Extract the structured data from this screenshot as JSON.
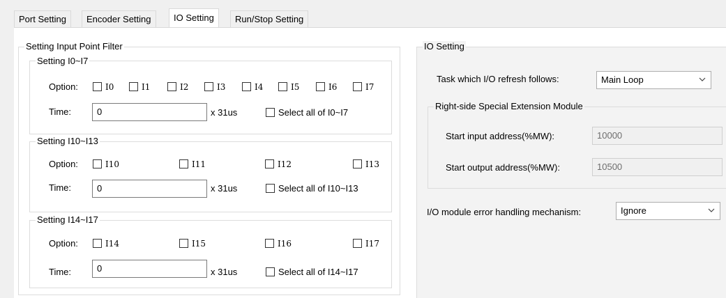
{
  "tabs": [
    "Port Setting",
    "Encoder Setting",
    "IO Setting",
    "Run/Stop Setting"
  ],
  "filter": {
    "title": "Setting Input Point Filter",
    "groups": [
      {
        "title": "Setting I0~I7",
        "option_label": "Option:",
        "options": [
          "I0",
          "I1",
          "I2",
          "I3",
          "I4",
          "I5",
          "I6",
          "I7"
        ],
        "time_label": "Time:",
        "time_value": "0",
        "unit": "x 31us",
        "select_all": "Select all of I0~I7"
      },
      {
        "title": "Setting I10~I13",
        "option_label": "Option:",
        "options": [
          "I10",
          "I11",
          "I12",
          "I13"
        ],
        "time_label": "Time:",
        "time_value": "0",
        "unit": "x 31us",
        "select_all": "Select all of I10~I13"
      },
      {
        "title": "Setting I14~I17",
        "option_label": "Option:",
        "options": [
          "I14",
          "I15",
          "I16",
          "I17"
        ],
        "time_label": "Time:",
        "time_value": "0",
        "unit": "x 31us",
        "select_all": "Select all of I14~I17"
      }
    ]
  },
  "io": {
    "title": "IO Setting",
    "refresh_label": "Task which I/O refresh follows:",
    "refresh_value": "Main Loop",
    "ext": {
      "title": "Right-side Special Extension Module",
      "input_label": "Start input address(%MW):",
      "input_value": "10000",
      "output_label": "Start output  address(%MW):",
      "output_value": "10500"
    },
    "error_label": "I/O module error handling mechanism:",
    "error_value": "Ignore"
  },
  "icons": {
    "dropdown": "chevron-down-icon"
  }
}
